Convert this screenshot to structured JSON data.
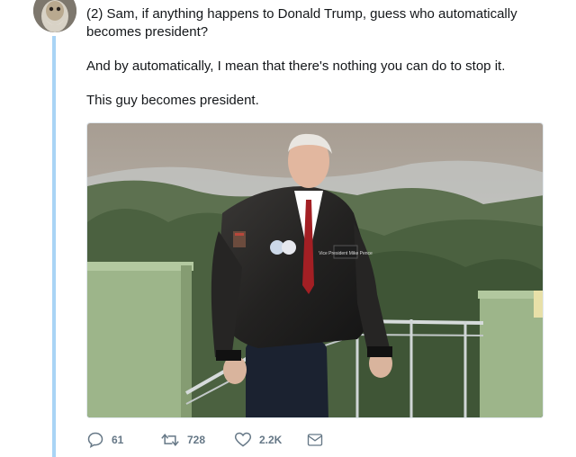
{
  "header": {
    "fragment": ""
  },
  "tweet": {
    "paragraphs": [
      "(2) Sam, if anything happens to Donald Trump, guess who automatically becomes president?",
      "And by automatically, I mean that there's nothing you can do to stop it.",
      "This guy becomes president."
    ],
    "patch_text": "Vice President Mike Pence"
  },
  "actions": {
    "reply_count": "61",
    "retweet_count": "728",
    "like_count": "2.2K"
  },
  "icons": {
    "reply": "reply-icon",
    "retweet": "retweet-icon",
    "like": "heart-icon",
    "message": "mail-icon"
  },
  "colors": {
    "thread_line": "#a9d4f5",
    "text": "#14171a",
    "muted": "#657786"
  }
}
